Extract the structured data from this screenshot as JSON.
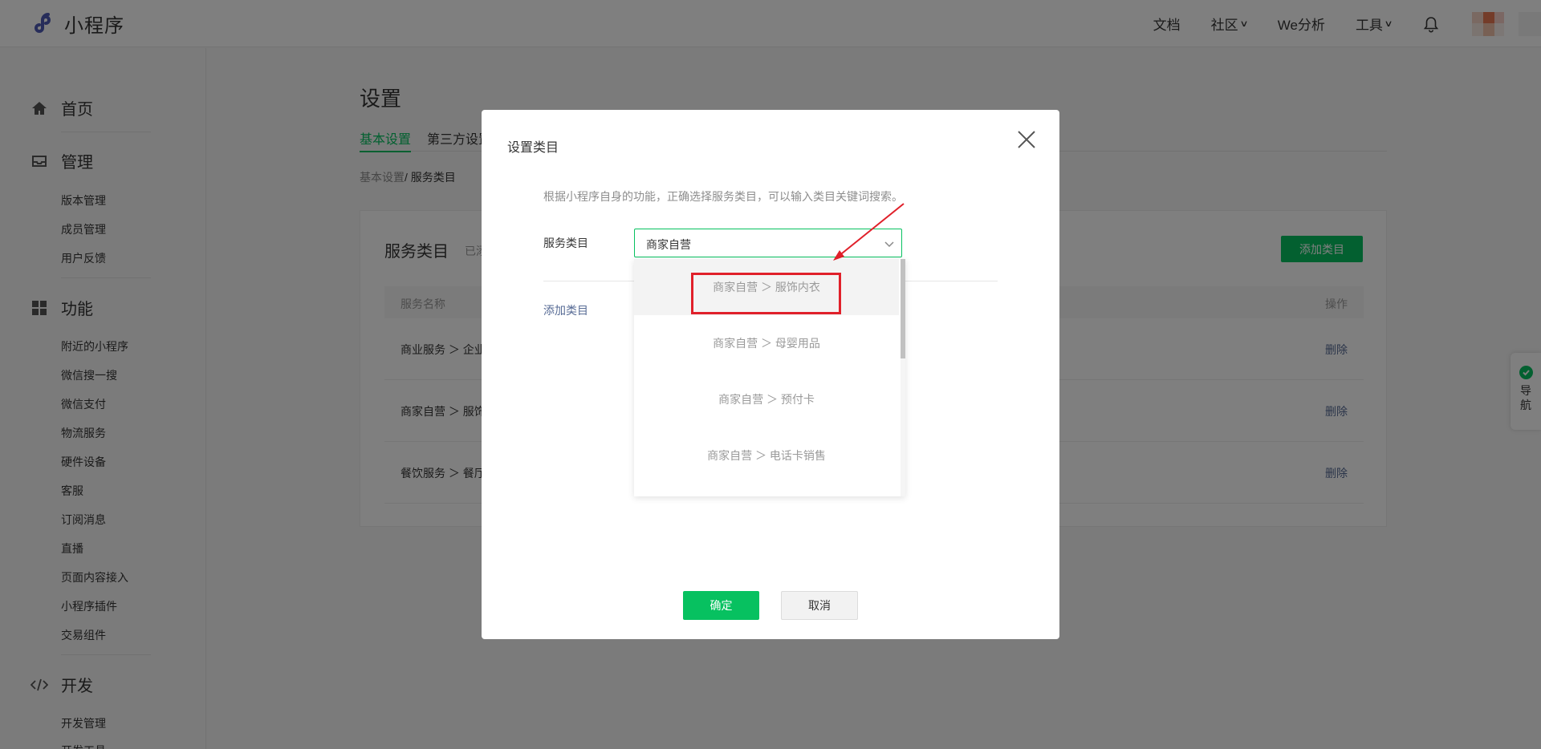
{
  "app": {
    "title": "小程序"
  },
  "topnav": {
    "items": [
      {
        "label": "文档",
        "has_dropdown": false
      },
      {
        "label": "社区",
        "has_dropdown": true
      },
      {
        "label": "We分析",
        "has_dropdown": false
      },
      {
        "label": "工具",
        "has_dropdown": true
      }
    ],
    "bell_icon": "bell-icon"
  },
  "sidebar": {
    "sections": [
      {
        "label": "首页",
        "icon": "home-icon",
        "items": []
      },
      {
        "label": "管理",
        "icon": "inbox-icon",
        "items": [
          "版本管理",
          "成员管理",
          "用户反馈"
        ]
      },
      {
        "label": "功能",
        "icon": "grid-icon",
        "items": [
          "附近的小程序",
          "微信搜一搜",
          "微信支付",
          "物流服务",
          "硬件设备",
          "客服",
          "订阅消息",
          "直播",
          "页面内容接入",
          "小程序插件",
          "交易组件"
        ]
      },
      {
        "label": "开发",
        "icon": "code-icon",
        "items": [
          "开发管理",
          "开发工具"
        ]
      }
    ]
  },
  "page": {
    "title": "设置",
    "tabs": [
      {
        "label": "基本设置",
        "active": true
      },
      {
        "label": "第三方设置",
        "active": false
      }
    ],
    "breadcrumb": {
      "parent": "基本设置",
      "current": "/ 服务类目"
    }
  },
  "card": {
    "title": "服务类目",
    "subtitle": "已添",
    "add_button": "添加类目",
    "columns": [
      "服务名称",
      "操作"
    ],
    "rows": [
      {
        "name": "商业服务 ＞ 企业",
        "action": "删除"
      },
      {
        "name": "商家自营 ＞ 服饰",
        "action": "删除"
      },
      {
        "name": "餐饮服务 ＞ 餐厅",
        "action": "删除"
      }
    ]
  },
  "modal": {
    "title": "设置类目",
    "hint": "根据小程序自身的功能，正确选择服务类目，可以输入类目关键词搜索。",
    "field_label": "服务类目",
    "select_value": "商家自营",
    "dropdown_options": [
      "商家自营 ＞ 服饰内衣",
      "商家自营 ＞ 母婴用品",
      "商家自营 ＞ 预付卡",
      "商家自营 ＞ 电话卡销售"
    ],
    "hovered_option_index": 0,
    "add_link": "添加类目",
    "ok_button": "确定",
    "cancel_button": "取消"
  },
  "float_nav": {
    "label": "导航"
  },
  "colors": {
    "brand_green": "#07c160",
    "link_blue": "#576b95",
    "annotation_red": "#e0202a",
    "overlay": "rgba(0,0,0,0.5)"
  }
}
